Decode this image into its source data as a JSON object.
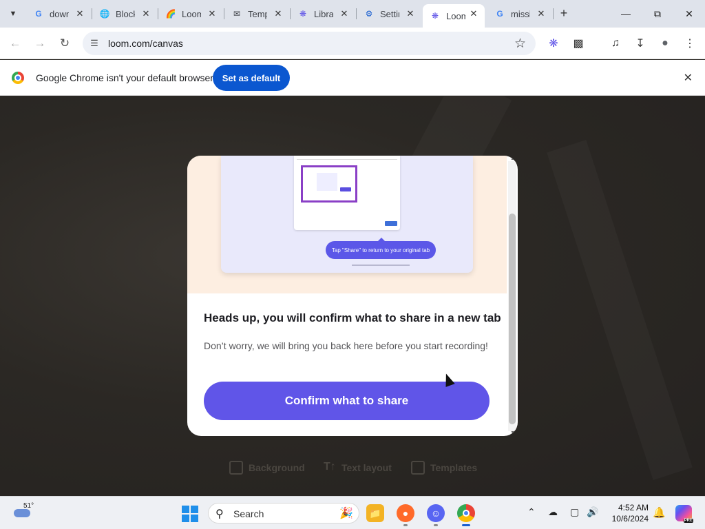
{
  "tabs": [
    {
      "title": "download",
      "favicon": "google-icon",
      "active": false
    },
    {
      "title": "Block",
      "favicon": "globe-icon",
      "active": false
    },
    {
      "title": "Loom",
      "favicon": "rainbow-icon",
      "active": false
    },
    {
      "title": "Templates",
      "favicon": "envelope-icon",
      "active": false
    },
    {
      "title": "Library",
      "favicon": "loom-icon",
      "active": false
    },
    {
      "title": "Settings",
      "favicon": "gear-icon",
      "active": false
    },
    {
      "title": "Loom",
      "favicon": "loom-icon",
      "active": true
    },
    {
      "title": "missing",
      "favicon": "google-icon",
      "active": false
    }
  ],
  "toolbar": {
    "url": "loom.com/canvas"
  },
  "infobar": {
    "message": "Google Chrome isn't your default browser",
    "button_label": "Set as default"
  },
  "modal": {
    "pill_text": "Tap \"Share\" to return to your original tab",
    "heading": "Heads up, you will confirm what to share in a new tab",
    "subtext": "Don’t worry, we will bring you back here before you start recording!",
    "confirm_label": "Confirm what to share"
  },
  "canvas_tools": [
    {
      "label": "Background",
      "icon": "image-icon"
    },
    {
      "label": "Text layout",
      "icon": "text-icon"
    },
    {
      "label": "Templates",
      "icon": "monitor-icon"
    }
  ],
  "taskbar": {
    "temperature": "51°",
    "search_label": "Search",
    "time": "4:52 AM",
    "date": "10/6/2024",
    "copilot_badge": "PRE"
  },
  "colors": {
    "accent": "#6055e8",
    "chrome_blue": "#0b57d0",
    "hero_bg": "#fdeee1"
  }
}
